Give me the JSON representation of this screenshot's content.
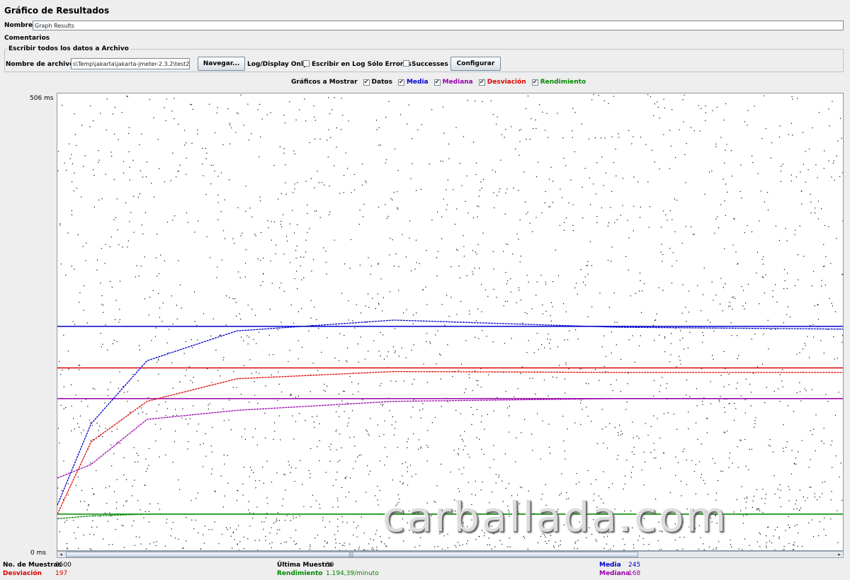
{
  "window": {
    "title": "Gráfico de Resultados"
  },
  "name_row": {
    "label": "Nombre:",
    "value": "Graph Results"
  },
  "comments": {
    "label": "Comentarios"
  },
  "file_section": {
    "legend": "Escribir todos los datos a Archivo",
    "filename_label": "Nombre de archivo",
    "filename_value": "s\\Temp\\jakarta\\jakarta-jmeter-2.3.2\\test2",
    "browse_button": "Navegar...",
    "log_display_label": "Log/Display Only:",
    "errors_only_label": "Escribir en Log Sólo Errores",
    "errors_only_checked": false,
    "successes_label": "Successes",
    "successes_checked": false,
    "configure_button": "Configurar"
  },
  "graph_toggles": {
    "label": "Gráficos a Mostrar",
    "items": [
      {
        "label": "Datos",
        "checked": true,
        "color": "#000000"
      },
      {
        "label": "Media",
        "checked": true,
        "color": "#0000cc"
      },
      {
        "label": "Mediana",
        "checked": true,
        "color": "#9900aa"
      },
      {
        "label": "Desviación",
        "checked": true,
        "color": "#dd0000"
      },
      {
        "label": "Rendimiento",
        "checked": true,
        "color": "#008800"
      }
    ]
  },
  "chart_data": {
    "type": "line",
    "ylim": [
      0,
      506
    ],
    "y_max_label": "506 ms",
    "y_min_label": "0 ms",
    "x_samples": 3500,
    "series": [
      {
        "name": "Media",
        "color": "#0000cc",
        "final": 245,
        "points": [
          [
            0,
            50
          ],
          [
            150,
            140
          ],
          [
            400,
            210
          ],
          [
            800,
            243
          ],
          [
            1500,
            255
          ],
          [
            2500,
            247
          ],
          [
            3500,
            245
          ]
        ]
      },
      {
        "name": "Mediana",
        "color": "#9900aa",
        "final": 168,
        "points": [
          [
            0,
            80
          ],
          [
            150,
            95
          ],
          [
            400,
            145
          ],
          [
            800,
            155
          ],
          [
            1500,
            165
          ],
          [
            2500,
            168
          ],
          [
            3500,
            168
          ]
        ]
      },
      {
        "name": "Desviación",
        "color": "#dd0000",
        "final": 197,
        "points": [
          [
            0,
            40
          ],
          [
            150,
            120
          ],
          [
            400,
            165
          ],
          [
            800,
            190
          ],
          [
            1500,
            198
          ],
          [
            2500,
            197
          ],
          [
            3500,
            197
          ]
        ]
      },
      {
        "name": "Rendimiento",
        "color": "#008800",
        "final": 40,
        "points": [
          [
            0,
            35
          ],
          [
            150,
            38
          ],
          [
            400,
            40
          ],
          [
            1500,
            40
          ],
          [
            3500,
            40
          ]
        ]
      }
    ],
    "reference_lines": [
      {
        "name": "Media",
        "value": 248,
        "color": "#0000cc"
      },
      {
        "name": "Desviación",
        "value": 202,
        "color": "#dd0000"
      },
      {
        "name": "Mediana",
        "value": 168,
        "color": "#9900aa"
      },
      {
        "name": "Rendimiento",
        "value": 40,
        "color": "#008800"
      }
    ]
  },
  "watermark": {
    "text": "carballada.com"
  },
  "stats": {
    "samples_label": "No. de Muestras",
    "samples_value": "3500",
    "last_label": "Última Muestra",
    "last_value": "39",
    "average_label": "Media",
    "average_value": "245",
    "deviation_label": "Desviación",
    "deviation_value": "197",
    "throughput_label": "Rendimiento",
    "throughput_value": "1.194,39/minuto",
    "median_label": "Mediana",
    "median_value": "168"
  },
  "scrollbar": {
    "thumb_grip": "|||",
    "left_arrow": "◂",
    "right_arrow": "▸"
  }
}
